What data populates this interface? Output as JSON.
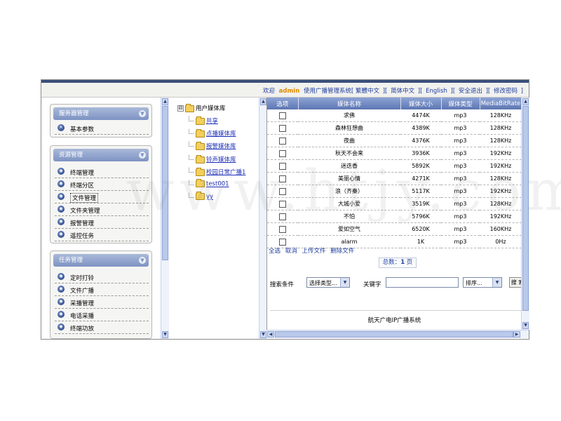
{
  "topbar": {
    "welcome": "欢迎",
    "username": "admin",
    "system_prefix": "使用广播管理系统[",
    "links": [
      "繁體中文",
      "简体中文",
      "English",
      "安全退出",
      "修改密码"
    ],
    "separator": "][",
    "close_bracket": "]"
  },
  "sidebar": {
    "panels": [
      {
        "title": "服务器管理",
        "items": [
          {
            "label": "基本参数",
            "icon": "settings-icon"
          }
        ]
      },
      {
        "title": "资源管理",
        "items": [
          {
            "label": "终端管理",
            "icon": "terminal-icon"
          },
          {
            "label": "终端分区",
            "icon": "zone-icon"
          },
          {
            "label": "文件管理",
            "icon": "file-icon",
            "active": true
          },
          {
            "label": "文件夹管理",
            "icon": "folder-icon"
          },
          {
            "label": "报警管理",
            "icon": "alarm-icon"
          },
          {
            "label": "遥控任务",
            "icon": "remote-icon"
          }
        ]
      },
      {
        "title": "任务管理",
        "items": [
          {
            "label": "定时打铃",
            "icon": "clock-icon"
          },
          {
            "label": "文件广播",
            "icon": "broadcast-icon"
          },
          {
            "label": "采播管理",
            "icon": "capture-icon"
          },
          {
            "label": "电话采播",
            "icon": "phone-icon"
          },
          {
            "label": "终端功放",
            "icon": "amplifier-icon"
          }
        ]
      }
    ]
  },
  "tree": {
    "root": "用户媒体库",
    "root_expander": "⊟",
    "nodes": [
      "共享",
      "点播媒体库",
      "报警媒体库",
      "铃声媒体库",
      "校园日常广播1",
      "test001",
      "yy"
    ]
  },
  "table": {
    "headers": [
      "选项",
      "媒体名称",
      "媒体大小",
      "媒体类型",
      "MediaBitRate"
    ],
    "rows": [
      {
        "name": "求佛",
        "size": "4474K",
        "type": "mp3",
        "bitrate": "128KHz"
      },
      {
        "name": "森林狂想曲",
        "size": "4389K",
        "type": "mp3",
        "bitrate": "128KHz"
      },
      {
        "name": "夜曲",
        "size": "4376K",
        "type": "mp3",
        "bitrate": "128KHz"
      },
      {
        "name": "秋天不会来",
        "size": "3936K",
        "type": "mp3",
        "bitrate": "192KHz"
      },
      {
        "name": "迷迭香",
        "size": "5892K",
        "type": "mp3",
        "bitrate": "192KHz"
      },
      {
        "name": "美丽心情",
        "size": "4271K",
        "type": "mp3",
        "bitrate": "128KHz"
      },
      {
        "name": "浪（齐秦）",
        "size": "5117K",
        "type": "mp3",
        "bitrate": "192KHz"
      },
      {
        "name": "大城小爱",
        "size": "3519K",
        "type": "mp3",
        "bitrate": "128KHz"
      },
      {
        "name": "不怕",
        "size": "5796K",
        "type": "mp3",
        "bitrate": "192KHz"
      },
      {
        "name": "爱如空气",
        "size": "6520K",
        "type": "mp3",
        "bitrate": "160KHz"
      },
      {
        "name": "alarm",
        "size": "1K",
        "type": "mp3",
        "bitrate": "0Hz"
      }
    ]
  },
  "actions": [
    "全选",
    "取消",
    "上传文件",
    "删除文件"
  ],
  "pager": {
    "prefix": "总数：",
    "count": "1",
    "suffix": " 页"
  },
  "search": {
    "condition_label": "搜索条件",
    "type_select": "选择类型...",
    "keyword_label": "关键字",
    "keyword_value": "",
    "sort_select": "排序...",
    "search_button": "搜 索"
  },
  "footer": "航天广电IP广播系统",
  "watermark": "www.htjy.com"
}
